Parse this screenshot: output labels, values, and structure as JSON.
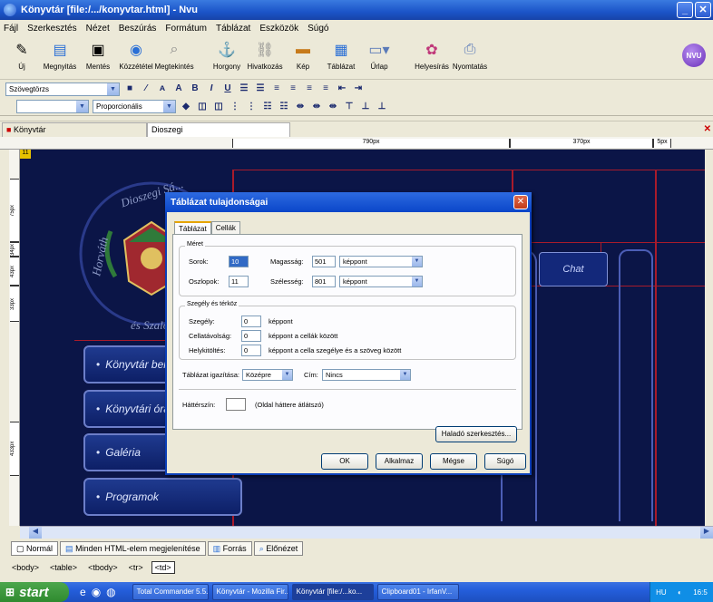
{
  "window": {
    "title": "Könyvtár [file:/.../konyvtar.html] - Nvu",
    "min": "_",
    "close": "✕"
  },
  "menu": [
    "Fájl",
    "Szerkesztés",
    "Nézet",
    "Beszúrás",
    "Formátum",
    "Táblázat",
    "Eszközök",
    "Súgó"
  ],
  "toolbar": {
    "buttons": [
      {
        "label": "Új",
        "icon": "new-file-icon"
      },
      {
        "label": "Megnyitás",
        "icon": "open-icon"
      },
      {
        "label": "Mentés",
        "icon": "save-icon"
      },
      {
        "label": "Közzététel",
        "icon": "publish-icon"
      },
      {
        "label": "Megtekintés",
        "icon": "browse-icon"
      },
      {
        "label": "Horgony",
        "icon": "anchor-icon"
      },
      {
        "label": "Hivatkozás",
        "icon": "link-icon"
      },
      {
        "label": "Kép",
        "icon": "image-icon"
      },
      {
        "label": "Táblázat",
        "icon": "table-icon"
      },
      {
        "label": "Űrlap",
        "icon": "form-icon"
      },
      {
        "label": "Helyesírás",
        "icon": "spell-icon"
      },
      {
        "label": "Nyomtatás",
        "icon": "print-icon"
      }
    ],
    "logo": "NVU"
  },
  "format1": {
    "style_select": "Szövegtörzs"
  },
  "format2": {
    "font_select": "",
    "width_select": "Proporcionális"
  },
  "doc_tabs": {
    "first": "Könyvtár",
    "second": "Dioszegi",
    "close": "✕"
  },
  "ruler": {
    "h1": "790px",
    "h2": "370px",
    "h3": "5px",
    "v1": "75px",
    "v2": "34px",
    "v3": "43px",
    "v4": "33px",
    "v5": "433px"
  },
  "canvas": {
    "marker": "11",
    "menu_buttons": [
      "Könyvtár bemutatása",
      "Könyvtári órák",
      "Galéria",
      "Programok"
    ],
    "chat": "Chat",
    "logo_top": "Dioszegi Sá...",
    "logo_left": "Horváth",
    "logo_bottom": "és Szaló..."
  },
  "mode_tabs": [
    "Normál",
    "Minden HTML-elem megjelenítése",
    "Forrás",
    "Előnézet"
  ],
  "tag_bar": [
    "<body>",
    "<table>",
    "<tbody>",
    "<tr>",
    "<td>"
  ],
  "taskbar": {
    "start": "start",
    "tasks": [
      "Total Commander 5.5...",
      "Könyvtár - Mozilla Fir...",
      "Könyvtár [file:/...ko...",
      "Clipboard01 - IrfanV..."
    ],
    "tray_lang": "HU",
    "tray_time": "16:5"
  },
  "dialog": {
    "title": "Táblázat tulajdonságai",
    "close": "✕",
    "tabs": [
      "Táblázat",
      "Cellák"
    ],
    "size_group": "Méret",
    "rows_label": "Sorok:",
    "rows_value": "10",
    "cols_label": "Oszlopok:",
    "cols_value": "11",
    "height_label": "Magasság:",
    "height_value": "501",
    "height_unit": "képpont",
    "width_label": "Szélesség:",
    "width_value": "801",
    "width_unit": "képpont",
    "border_group": "Szegély és térköz",
    "border_label": "Szegély:",
    "border_value": "0",
    "border_unit": "képpont",
    "spacing_label": "Cellatávolság:",
    "spacing_value": "0",
    "spacing_unit": "képpont a cellák között",
    "padding_label": "Helykitöltés:",
    "padding_value": "0",
    "padding_unit": "képpont a cella szegélye és a szöveg között",
    "align_label": "Táblázat igazítása:",
    "align_value": "Középre",
    "caption_label": "Cím:",
    "caption_value": "Nincs",
    "bg_label": "Háttérszín:",
    "bg_note": "(Oldal háttere átlátszó)",
    "advanced": "Haladó szerkesztés...",
    "ok": "OK",
    "apply": "Alkalmaz",
    "cancel": "Mégse",
    "help": "Súgó"
  }
}
